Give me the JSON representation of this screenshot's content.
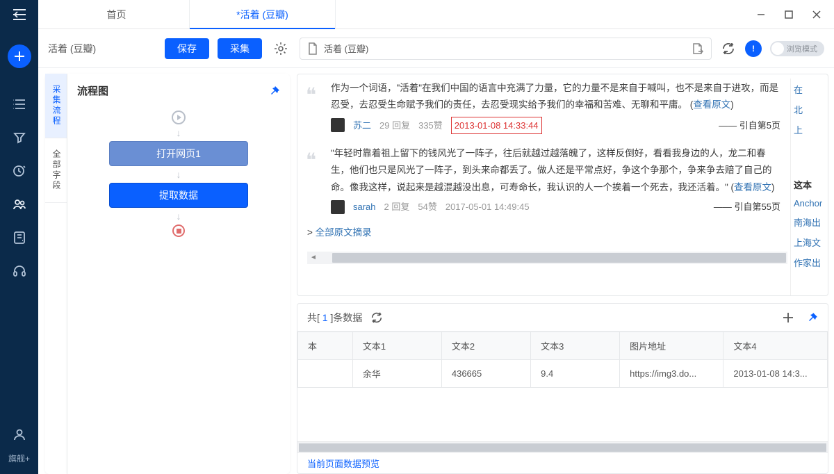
{
  "tabs": {
    "home": "首页",
    "active": "*活着 (豆瓣)"
  },
  "window": {
    "min": "—",
    "max": "▢",
    "close": "✕"
  },
  "toolbar": {
    "title": "活着 (豆瓣)",
    "save": "保存",
    "collect": "采集",
    "address": "活着 (豆瓣)",
    "browse_mode": "浏览模式"
  },
  "rail": {
    "flagship": "旗舰+"
  },
  "left_tabs": {
    "flow": "采集流程",
    "fields": "全部字段"
  },
  "flow": {
    "title": "流程图",
    "node1": "打开网页1",
    "node2": "提取数据"
  },
  "page": {
    "q1_text": "作为一个词语，\"活着\"在我们中国的语言中充满了力量，它的力量不是来自于喊叫，也不是来自于进攻，而是忍受，去忍受生命赋予我们的责任，去忍受现实给予我们的幸福和苦难、无聊和平庸。 (",
    "view_original": "查看原文",
    "q1_user": "苏二",
    "q1_reply": "29 回复",
    "q1_like": "335赞",
    "q1_time": "2013-01-08 14:33:44",
    "q1_from": "—— 引自第5页",
    "q2_text": "\"年轻时靠着祖上留下的钱风光了一阵子，往后就越过越落魄了，这样反倒好，看看我身边的人，龙二和春生，他们也只是风光了一阵子，到头来命都丢了。做人还是平常点好，争这个争那个，争来争去赔了自己的命。像我这样，说起来是越混越没出息，可寿命长，我认识的人一个挨着一个死去，我还活着。\" (",
    "q2_user": "sarah",
    "q2_reply": "2 回复",
    "q2_like": "54赞",
    "q2_time": "2017-05-01 14:49:45",
    "q2_from": "—— 引自第55页",
    "all_excerpts_prefix": "> ",
    "all_excerpts": "全部原文摘录",
    "side": {
      "s0": "在",
      "s1": "北",
      "s2": "上",
      "head": "这本",
      "l1": "Anchor",
      "l2": "南海出",
      "l3": "上海文",
      "l4": "作家出"
    }
  },
  "data_panel": {
    "label_pre": "共[ ",
    "count": "1",
    "label_post": " ]条数据",
    "headers": [
      "本",
      "文本1",
      "文本2",
      "文本3",
      "图片地址",
      "文本4"
    ],
    "row": [
      "",
      "余华",
      "436665",
      "9.4",
      "https://img3.do...",
      "2013-01-08 14:3..."
    ],
    "footer": "当前页面数据预览"
  }
}
